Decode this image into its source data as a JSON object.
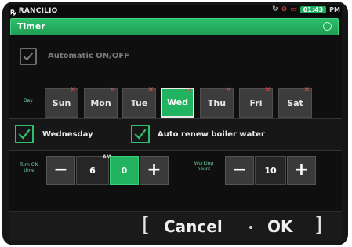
{
  "status": {
    "brand": "RANCILIO",
    "time": "01:43",
    "ampm": "PM"
  },
  "header": {
    "title": "Timer"
  },
  "automatic": {
    "label": "Automatic ON/OFF",
    "checked": true
  },
  "days": {
    "label": "Day",
    "items": [
      {
        "label": "Sun",
        "active": false
      },
      {
        "label": "Mon",
        "active": false
      },
      {
        "label": "Tue",
        "active": false
      },
      {
        "label": "Wed",
        "active": true
      },
      {
        "label": "Thu",
        "active": false
      },
      {
        "label": "Fri",
        "active": false
      },
      {
        "label": "Sat",
        "active": false
      }
    ]
  },
  "options": {
    "day_label": "Wednesday",
    "auto_renew_label": "Auto renew boiler water"
  },
  "turn_on": {
    "label_line1": "Turn ON",
    "label_line2": "time",
    "period": "AM",
    "hour": "6",
    "minute": "0"
  },
  "working": {
    "label_line1": "Working",
    "label_line2": "hours",
    "value": "10"
  },
  "controls": {
    "minus": "−",
    "plus": "+"
  },
  "footer": {
    "cancel_label": "Cancel",
    "ok_label": "OK",
    "left_bracket": "[",
    "right_bracket": "]"
  },
  "colors": {
    "accent_green": "#21b35f",
    "alert_red": "#e34a4a"
  }
}
